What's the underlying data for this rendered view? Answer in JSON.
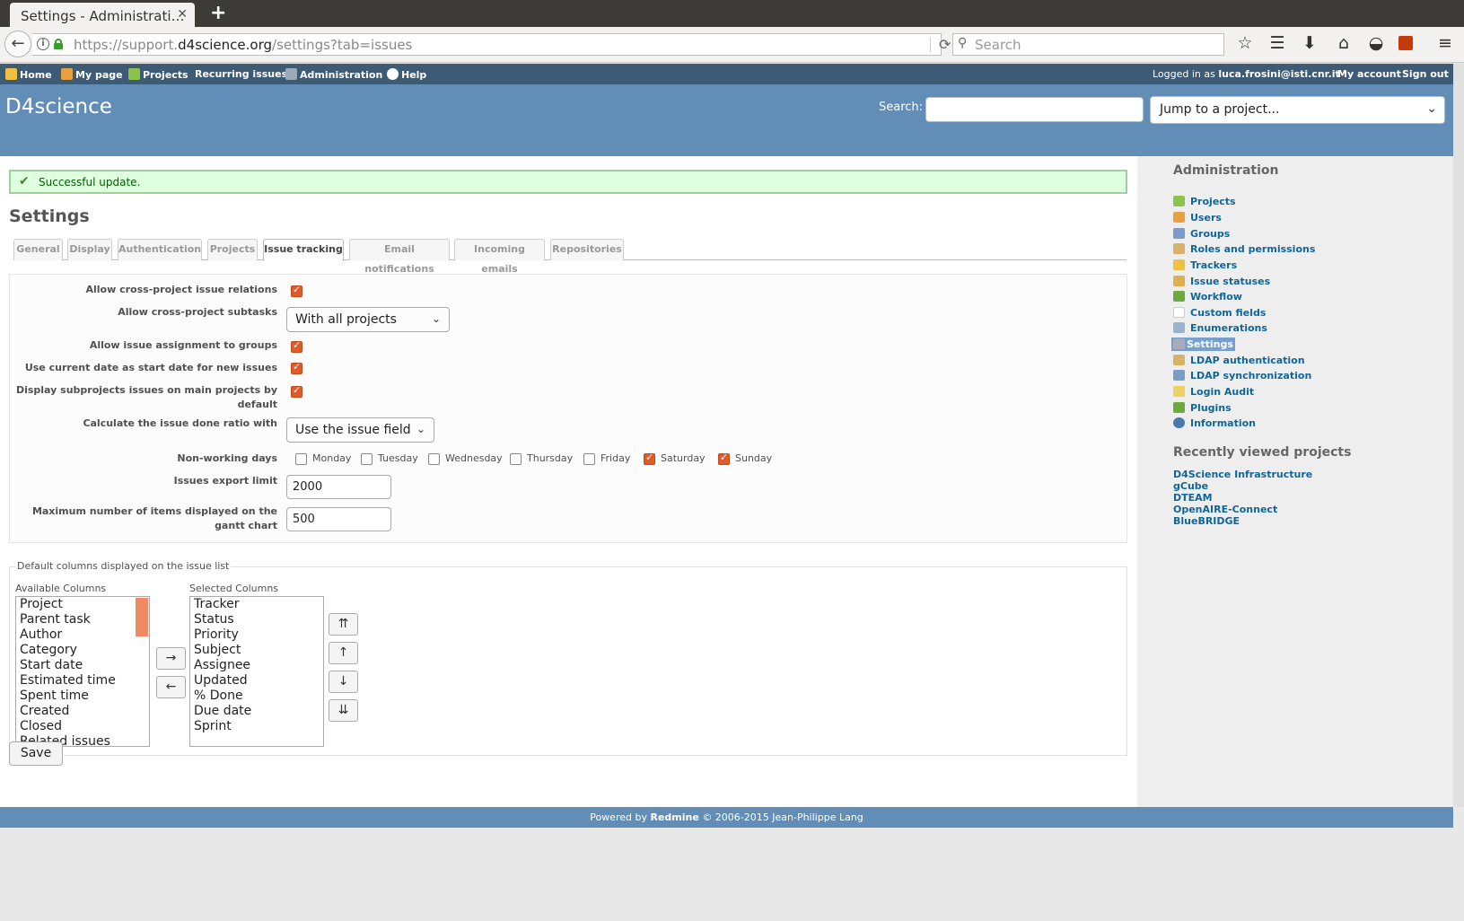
{
  "browser": {
    "tab_title": "Settings - Administrati…",
    "url_prefix": "https://support.",
    "url_domain": "d4science.org",
    "url_path": "/settings?tab=issues",
    "search_placeholder": "Search"
  },
  "top_menu": {
    "items": [
      "Home",
      "My page",
      "Projects",
      "Recurring issues",
      "Administration",
      "Help"
    ],
    "logged_as_label": "Logged in as",
    "logged_user": "luca.frosini@isti.cnr.it",
    "my_account": "My account",
    "sign_out": "Sign out"
  },
  "header": {
    "site_title": "D4science",
    "search_label": "Search:",
    "jump_to_project": "Jump to a project..."
  },
  "flash": "Successful update.",
  "page_title": "Settings",
  "tabs": [
    "General",
    "Display",
    "Authentication",
    "Projects",
    "Issue tracking",
    "Email notifications",
    "Incoming emails",
    "Repositories"
  ],
  "selected_tab": "Issue tracking",
  "settings": {
    "cross_project_relations_label": "Allow cross-project issue relations",
    "cross_project_relations": true,
    "cross_project_subtasks_label": "Allow cross-project subtasks",
    "cross_project_subtasks_value": "With all projects",
    "group_assignment_label": "Allow issue assignment to groups",
    "group_assignment": true,
    "current_date_start_label": "Use current date as start date for new issues",
    "current_date_start": true,
    "display_subprojects_label": "Display subprojects issues on main projects by default",
    "display_subprojects": true,
    "done_ratio_label": "Calculate the issue done ratio with",
    "done_ratio_value": "Use the issue field",
    "non_working_days_label": "Non-working days",
    "days": [
      {
        "name": "Monday",
        "checked": false
      },
      {
        "name": "Tuesday",
        "checked": false
      },
      {
        "name": "Wednesday",
        "checked": false
      },
      {
        "name": "Thursday",
        "checked": false
      },
      {
        "name": "Friday",
        "checked": false
      },
      {
        "name": "Saturday",
        "checked": true
      },
      {
        "name": "Sunday",
        "checked": true
      }
    ],
    "export_limit_label": "Issues export limit",
    "export_limit": "2000",
    "gantt_limit_label": "Maximum number of items displayed on the gantt chart",
    "gantt_limit": "500"
  },
  "columns": {
    "legend": "Default columns displayed on the issue list",
    "available_label": "Available Columns",
    "selected_label": "Selected Columns",
    "available": [
      "Project",
      "Parent task",
      "Author",
      "Category",
      "Start date",
      "Estimated time",
      "Spent time",
      "Created",
      "Closed",
      "Related issues"
    ],
    "selected": [
      "Tracker",
      "Status",
      "Priority",
      "Subject",
      "Assignee",
      "Updated",
      "% Done",
      "Due date",
      "Sprint"
    ],
    "add_arrow": "→",
    "remove_arrow": "←",
    "move_top": "⇈",
    "move_up": "↑",
    "move_down": "↓",
    "move_bottom": "⇊"
  },
  "save_label": "Save",
  "sidebar": {
    "admin_title": "Administration",
    "items": [
      "Projects",
      "Users",
      "Groups",
      "Roles and permissions",
      "Trackers",
      "Issue statuses",
      "Workflow",
      "Custom fields",
      "Enumerations",
      "Settings",
      "LDAP authentication",
      "LDAP synchronization",
      "Login Audit",
      "Plugins",
      "Information"
    ],
    "selected": "Settings",
    "recent_title": "Recently viewed projects",
    "recent": [
      "D4Science Infrastructure",
      "gCube",
      "DTEAM",
      "OpenAIRE-Connect",
      "BlueBRIDGE"
    ]
  },
  "footer": {
    "powered_by": "Powered by",
    "redmine": "Redmine",
    "copyright": "© 2006-2015 Jean-Philippe Lang"
  }
}
